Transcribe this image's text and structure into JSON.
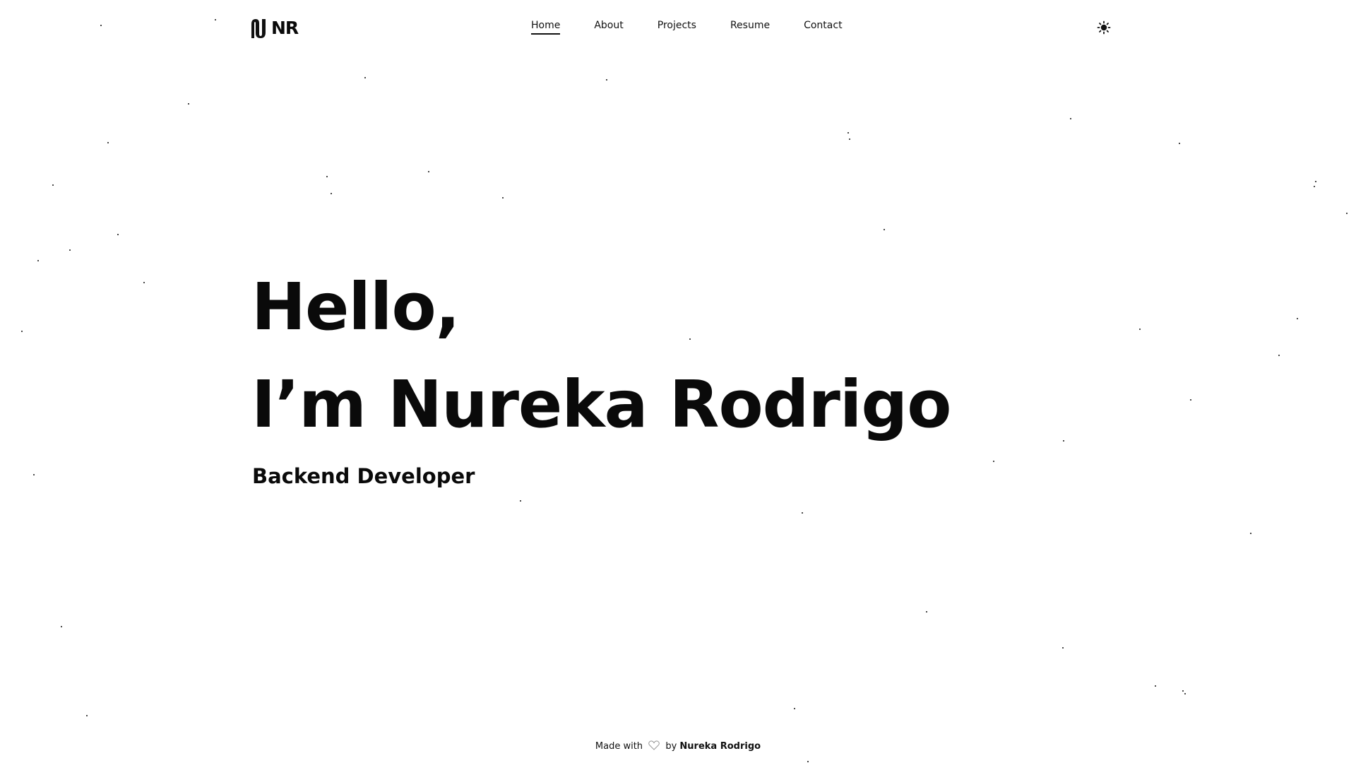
{
  "header": {
    "logo_text": "NR",
    "nav": [
      {
        "label": "Home",
        "active": true
      },
      {
        "label": "About",
        "active": false
      },
      {
        "label": "Projects",
        "active": false
      },
      {
        "label": "Resume",
        "active": false
      },
      {
        "label": "Contact",
        "active": false
      }
    ],
    "theme_toggle_icon": "sun-icon"
  },
  "hero": {
    "greeting": "Hello,",
    "name_line": "I’m Nureka Rodrigo",
    "role": "Backend Developer"
  },
  "footer": {
    "made_with": "Made with",
    "heart_icon": "heart-icon",
    "by": "by",
    "author": "Nureka Rodrigo"
  },
  "colors": {
    "background": "#ffffff",
    "text": "#0a0a0a",
    "accent": "#111111"
  }
}
